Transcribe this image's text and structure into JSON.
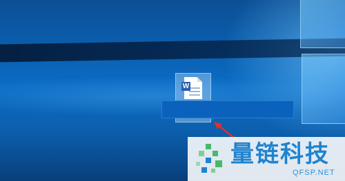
{
  "desktop": {
    "icon": {
      "name": "word-document",
      "badge_letter": "W"
    },
    "rename_field": {
      "value": ""
    }
  },
  "watermark": {
    "title": "量链科技",
    "subtitle": "QFSP.NET"
  },
  "colors": {
    "desktop_blue": "#0a6cc4",
    "selection_blue": "#0a62bd",
    "word_blue": "#2b5fad",
    "arrow_red": "#e0302a",
    "watermark_blue": "#1f83cf",
    "watermark_green": "#47b96b"
  }
}
